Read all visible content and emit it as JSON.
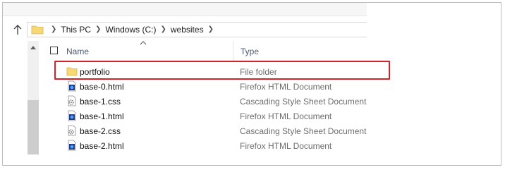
{
  "address_bar": {
    "crumbs": [
      "This PC",
      "Windows (C:)",
      "websites"
    ]
  },
  "columns": {
    "name": "Name",
    "type": "Type"
  },
  "files": [
    {
      "name": "portfolio",
      "type": "File folder",
      "icon": "folder-icon"
    },
    {
      "name": "base-0.html",
      "type": "Firefox HTML Document",
      "icon": "html-file-icon"
    },
    {
      "name": "base-1.css",
      "type": "Cascading Style Sheet Document",
      "icon": "css-file-icon"
    },
    {
      "name": "base-1.html",
      "type": "Firefox HTML Document",
      "icon": "html-file-icon"
    },
    {
      "name": "base-2.css",
      "type": "Cascading Style Sheet Document",
      "icon": "css-file-icon"
    },
    {
      "name": "base-2.html",
      "type": "Firefox HTML Document",
      "icon": "html-file-icon"
    }
  ],
  "colors": {
    "highlight": "#d2232a",
    "folder": "#f8d775",
    "html_icon": "#1e3a8a",
    "header_text": "#4a5a72"
  }
}
